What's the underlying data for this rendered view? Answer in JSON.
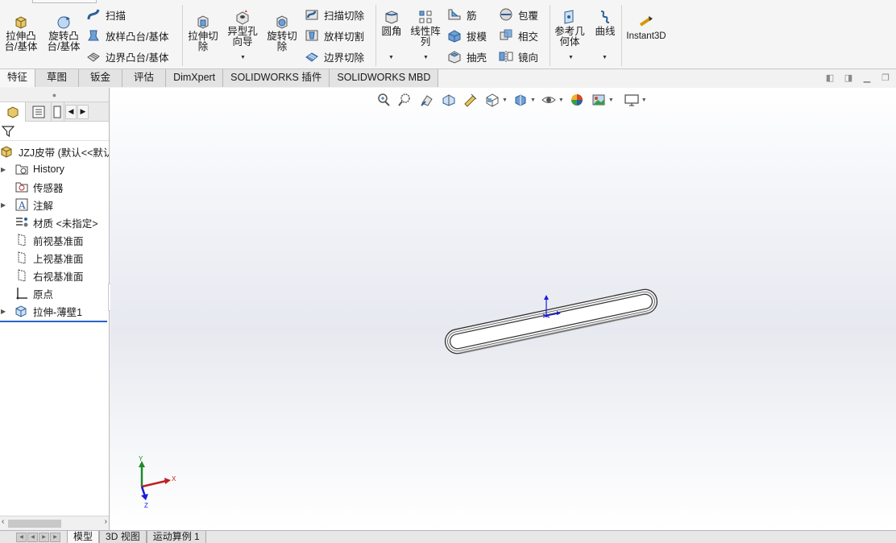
{
  "ribbon": {
    "extrude_boss": "拉伸凸台/基体",
    "revolve_boss": "旋转凸台/基体",
    "sweep": "扫描",
    "loft": "放样凸台/基体",
    "boundary": "边界凸台/基体",
    "extrude_cut": "拉伸切除",
    "hole_wizard": "异型孔向导",
    "revolve_cut": "旋转切除",
    "swept_cut": "扫描切除",
    "lofted_cut": "放样切割",
    "boundary_cut": "边界切除",
    "fillet": "圆角",
    "linear_pattern": "线性阵列",
    "rib": "筋",
    "draft": "拔模",
    "shell": "抽壳",
    "wrap": "包覆",
    "intersect": "相交",
    "mirror": "镜向",
    "ref_geometry": "参考几何体",
    "curves": "曲线",
    "instant3d": "Instant3D"
  },
  "tabs": [
    "特征",
    "草图",
    "钣金",
    "评估",
    "DimXpert",
    "SOLIDWORKS 插件",
    "SOLIDWORKS MBD"
  ],
  "active_tab": "特征",
  "tree": {
    "root": "JZJ皮带  (默认<<默认",
    "items": [
      {
        "label": "History",
        "icon": "history-folder-icon",
        "expandable": true
      },
      {
        "label": "传感器",
        "icon": "sensor-icon",
        "expandable": false
      },
      {
        "label": "注解",
        "icon": "annotation-icon",
        "expandable": true
      },
      {
        "label": "材质 <未指定>",
        "icon": "material-icon",
        "expandable": false
      },
      {
        "label": "前视基准面",
        "icon": "plane-icon",
        "expandable": false
      },
      {
        "label": "上视基准面",
        "icon": "plane-icon",
        "expandable": false
      },
      {
        "label": "右视基准面",
        "icon": "plane-icon",
        "expandable": false
      },
      {
        "label": "原点",
        "icon": "origin-icon",
        "expandable": false
      },
      {
        "label": "拉伸-薄壁1",
        "icon": "extrude-feature-icon",
        "expandable": true
      }
    ]
  },
  "triad": {
    "x": "X",
    "y": "Y",
    "z": "Z"
  },
  "bottom_tabs": [
    "模型",
    "3D 视图",
    "运动算例 1"
  ],
  "active_bottom_tab": "模型",
  "colors": {
    "accent": "#2a63c8",
    "viewport_gradient_mid": "#e7e9f0"
  }
}
